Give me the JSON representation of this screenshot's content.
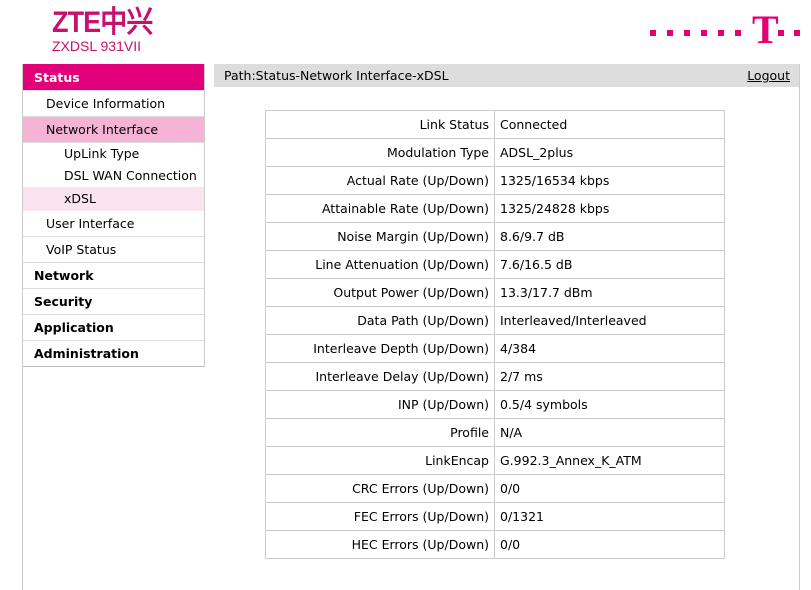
{
  "brand": {
    "logo": "ZTE中兴",
    "model": "ZXDSL 931VII",
    "carrier_logo": "T"
  },
  "menu": {
    "status": "Status",
    "device_info": "Device Information",
    "network_interface": "Network Interface",
    "uplink_type": "UpLink Type",
    "dsl_wan": "DSL WAN Connection",
    "xdsl": "xDSL",
    "user_interface": "User Interface",
    "voip_status": "VoIP Status",
    "network": "Network",
    "security": "Security",
    "application": "Application",
    "administration": "Administration"
  },
  "path": "Path:Status-Network Interface-xDSL",
  "logout": "Logout",
  "rows": [
    {
      "k": "Link Status",
      "v": "Connected"
    },
    {
      "k": "Modulation Type",
      "v": "ADSL_2plus"
    },
    {
      "k": "Actual Rate (Up/Down)",
      "v": "1325/16534 kbps"
    },
    {
      "k": "Attainable Rate (Up/Down)",
      "v": "1325/24828 kbps"
    },
    {
      "k": "Noise Margin (Up/Down)",
      "v": "8.6/9.7 dB"
    },
    {
      "k": "Line Attenuation (Up/Down)",
      "v": "7.6/16.5 dB"
    },
    {
      "k": "Output Power (Up/Down)",
      "v": "13.3/17.7 dBm"
    },
    {
      "k": "Data Path (Up/Down)",
      "v": "Interleaved/Interleaved"
    },
    {
      "k": "Interleave Depth (Up/Down)",
      "v": "4/384"
    },
    {
      "k": "Interleave Delay (Up/Down)",
      "v": "2/7 ms"
    },
    {
      "k": "INP (Up/Down)",
      "v": "0.5/4 symbols"
    },
    {
      "k": "Profile",
      "v": "N/A"
    },
    {
      "k": "LinkEncap",
      "v": "G.992.3_Annex_K_ATM"
    },
    {
      "k": "CRC Errors (Up/Down)",
      "v": "0/0"
    },
    {
      "k": "FEC Errors (Up/Down)",
      "v": "0/1321"
    },
    {
      "k": "HEC Errors (Up/Down)",
      "v": "0/0"
    }
  ]
}
